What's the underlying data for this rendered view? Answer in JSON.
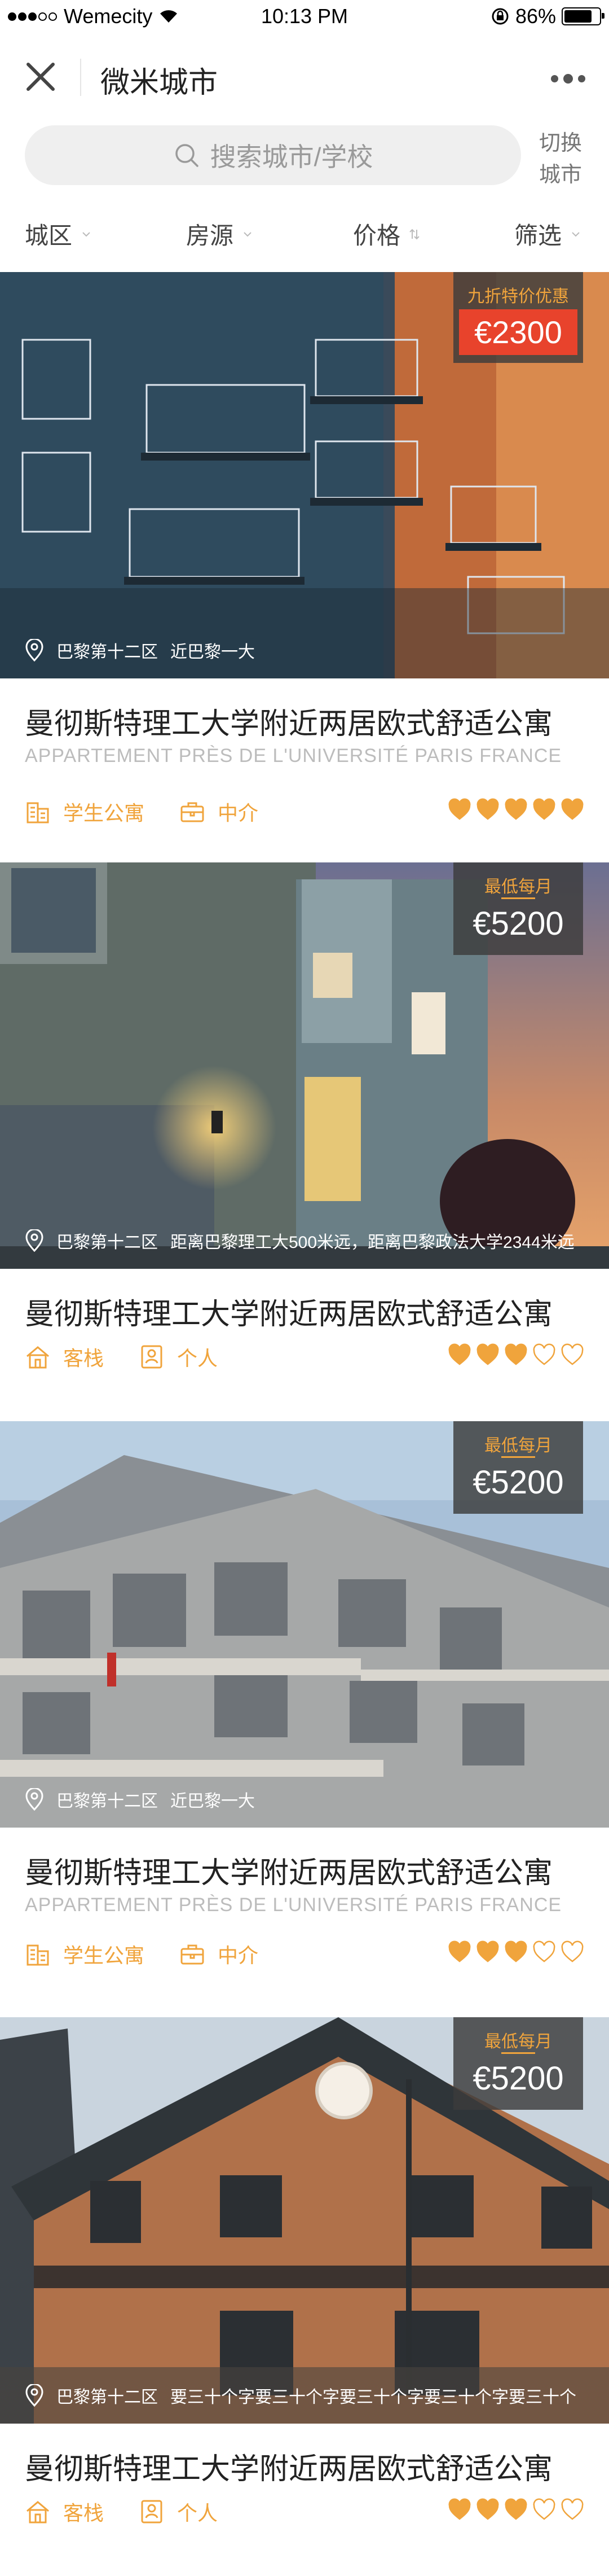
{
  "status_bar": {
    "carrier": "Wemecity",
    "time": "10:13 PM",
    "battery": "86%",
    "battery_level": 0.86
  },
  "nav": {
    "title": "微米城市"
  },
  "search": {
    "placeholder": "搜索城市/学校",
    "switch_city": "切换城市"
  },
  "filters": [
    {
      "label": "城区"
    },
    {
      "label": "房源"
    },
    {
      "label": "价格"
    },
    {
      "label": "筛选"
    }
  ],
  "listings": [
    {
      "price_label": "九折特价优惠",
      "price": "€2300",
      "location": "巴黎第十二区",
      "distance": "近巴黎一大",
      "title": "曼彻斯特理工大学附近两居欧式舒适公寓",
      "subtitle": "APPARTEMENT PRÈS DE L'UNIVERSITÉ PARIS FRANCE",
      "tag1": "学生公寓",
      "tag2": "中介",
      "rating": 5,
      "scene": "blue-balconies"
    },
    {
      "price_label": "最低每月",
      "price": "€5200",
      "location": "巴黎第十二区",
      "distance": "距离巴黎理工大500米远，距离巴黎政法大学2344米远",
      "title": "曼彻斯特理工大学附近两居欧式舒适公寓",
      "subtitle": "",
      "tag1": "客栈",
      "tag2": "个人",
      "rating": 3,
      "scene": "modern-house"
    },
    {
      "price_label": "最低每月",
      "price": "€5200",
      "location": "巴黎第十二区",
      "distance": "近巴黎一大",
      "title": "曼彻斯特理工大学附近两居欧式舒适公寓",
      "subtitle": "APPARTEMENT PRÈS DE L'UNIVERSITÉ PARIS FRANCE",
      "tag1": "学生公寓",
      "tag2": "中介",
      "rating": 3,
      "scene": "ornate-building"
    },
    {
      "price_label": "最低每月",
      "price": "€5200",
      "location": "巴黎第十二区",
      "distance": "要三十个字要三十个字要三十个字要三十个字要三十个",
      "title": "曼彻斯特理工大学附近两居欧式舒适公寓",
      "subtitle": "",
      "tag1": "客栈",
      "tag2": "个人",
      "rating": 3,
      "scene": "brick-house"
    }
  ],
  "colors": {
    "accent": "#f0a43c",
    "promo": "#e8432c",
    "heart_filled": "#f0a43c",
    "heart_empty": "#f0a43c"
  }
}
